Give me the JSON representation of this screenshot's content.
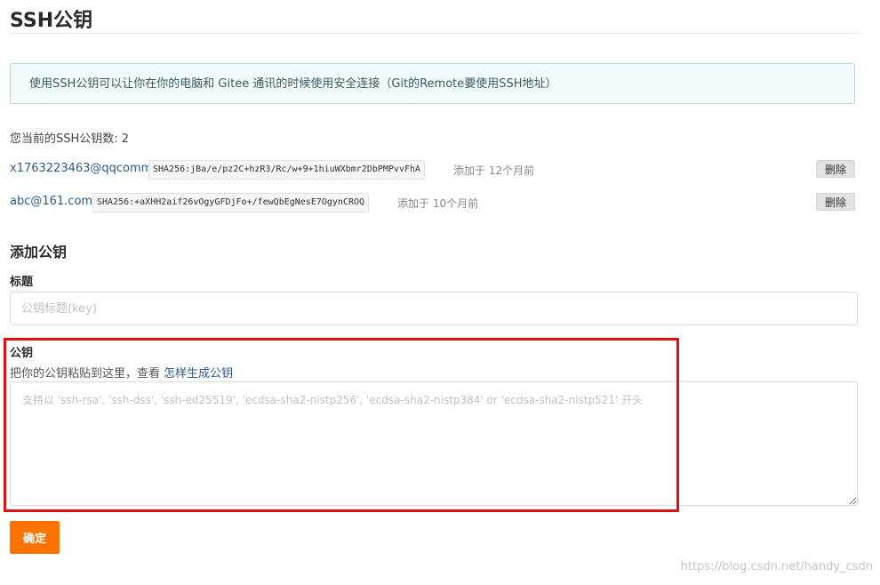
{
  "page": {
    "title": "SSH公钥"
  },
  "info": {
    "text": "使用SSH公钥可以让你在你的电脑和 Gitee 通讯的时候使用安全连接（Git的Remote要使用SSH地址）"
  },
  "keys": {
    "count_text": "您当前的SSH公钥数: 2",
    "delete_label": "删除",
    "items": [
      {
        "name": "x1763223463@qqcomm",
        "fingerprint": "SHA256:jBa/e/pz2C+hzR3/Rc/w+9+1hiuWXbmr2DbPMPvvFhA",
        "added": "添加于 12个月前"
      },
      {
        "name": "abc@161.com",
        "fingerprint": "SHA256:+aXHH2aif26vOgyGFDjFo+/fewQbEgNesE7OgynCROQ",
        "added": "添加于 10个月前"
      }
    ]
  },
  "add_key": {
    "section_title": "添加公钥",
    "title_label": "标题",
    "title_placeholder": "公钥标题(key)",
    "key_label": "公钥",
    "key_help_prefix": "把你的公钥粘贴到这里，查看 ",
    "key_help_link": "怎样生成公钥",
    "key_placeholder": "支持以 'ssh-rsa', 'ssh-dss', 'ssh-ed25519', 'ecdsa-sha2-nistp256', 'ecdsa-sha2-nistp384' or 'ecdsa-sha2-nistp521' 开头",
    "submit_label": "确定"
  },
  "watermark": "https://blog.csdn.net/handy_csdn",
  "colors": {
    "accent": "#fe7300",
    "highlight": "#e01010",
    "link": "#2c5a8a"
  }
}
